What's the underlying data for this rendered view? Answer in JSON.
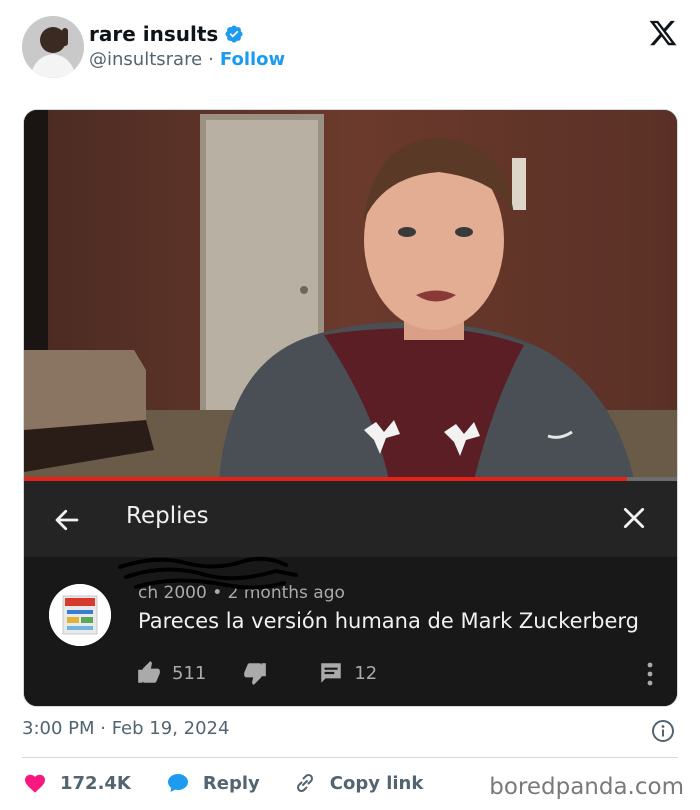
{
  "tweet": {
    "display_name": "rare insults",
    "handle": "@insultsrare",
    "separator": "·",
    "follow_label": "Follow",
    "timestamp": "3:00 PM · Feb 19, 2024",
    "likes": "172.4K",
    "reply_label": "Reply",
    "copy_link_label": "Copy link"
  },
  "embedded": {
    "replies_title": "Replies",
    "progress_fraction": 0.92,
    "comment": {
      "author": "ch 2000",
      "age": "• 2 months ago",
      "text": "Pareces la versión humana de Mark Zuckerberg",
      "likes": "511",
      "replies": "12"
    }
  },
  "watermark": "boredpanda.com",
  "colors": {
    "accent": "#1d9bf0",
    "like": "#f91880",
    "progress": "#e62117"
  }
}
